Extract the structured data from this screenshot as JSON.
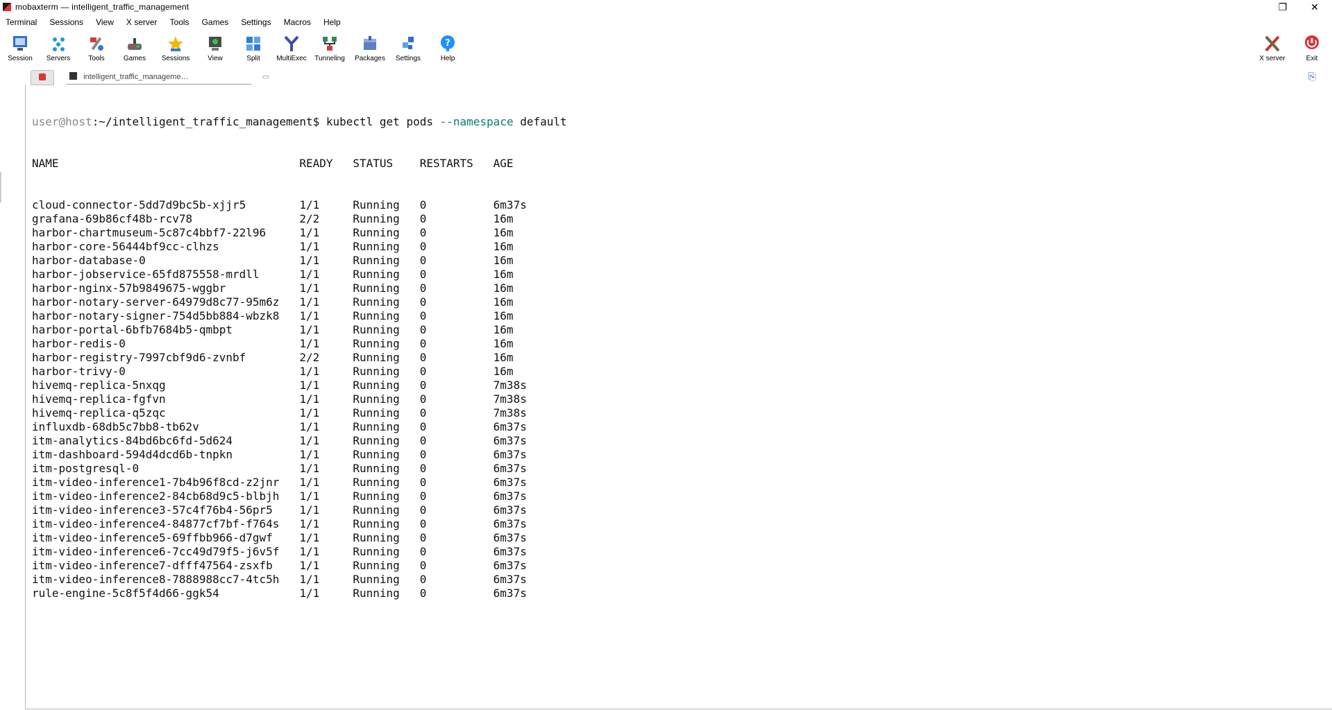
{
  "window": {
    "title": "mobaxterm — intelligent_traffic_management",
    "close_label": "✕",
    "restore_label": "❐"
  },
  "menu": [
    "Terminal",
    "Sessions",
    "View",
    "X server",
    "Tools",
    "Games",
    "Settings",
    "Macros",
    "Help"
  ],
  "toolbar": {
    "left": [
      {
        "label": "Session",
        "icon": "session-icon",
        "color": "#2f6fcf"
      },
      {
        "label": "Servers",
        "icon": "servers-icon",
        "color": "#1b9ad6"
      },
      {
        "label": "Tools",
        "icon": "tools-icon",
        "color": "#d23c3c"
      },
      {
        "label": "Games",
        "icon": "games-icon",
        "color": "#6a6a6a"
      },
      {
        "label": "Sessions",
        "icon": "star-icon",
        "color": "#f2b705"
      },
      {
        "label": "View",
        "icon": "view-icon",
        "color": "#4a4a4a"
      },
      {
        "label": "Split",
        "icon": "split-icon",
        "color": "#2c7fd6"
      },
      {
        "label": "MultiExec",
        "icon": "multiexec-icon",
        "color": "#3b4fa8"
      },
      {
        "label": "Tunneling",
        "icon": "tunneling-icon",
        "color": "#2e8b57"
      },
      {
        "label": "Packages",
        "icon": "packages-icon",
        "color": "#5b7fc7"
      },
      {
        "label": "Settings",
        "icon": "settings-icon",
        "color": "#2f6fcf"
      },
      {
        "label": "Help",
        "icon": "help-icon",
        "color": "#1e90ff"
      }
    ],
    "right": [
      {
        "label": "X server",
        "icon": "xserver-icon",
        "color": "#c0392b"
      },
      {
        "label": "Exit",
        "icon": "exit-icon",
        "color": "#e03030"
      }
    ]
  },
  "tabs": {
    "home_icon": "home-icon",
    "active_label": "intelligent_traffic_manageme…",
    "new_tab_icon": "new-tab-icon"
  },
  "terminal": {
    "prompt_host": "user@host",
    "prompt_path": ":~/intelligent_traffic_management$",
    "command": " kubectl get pods ",
    "flag": "--namespace",
    "arg": " default",
    "columns": [
      "NAME",
      "READY",
      "STATUS",
      "RESTARTS",
      "AGE"
    ],
    "rows": [
      [
        "cloud-connector-5dd7d9bc5b-xjjr5",
        "1/1",
        "Running",
        "0",
        "6m37s"
      ],
      [
        "grafana-69b86cf48b-rcv78",
        "2/2",
        "Running",
        "0",
        "16m"
      ],
      [
        "harbor-chartmuseum-5c87c4bbf7-22l96",
        "1/1",
        "Running",
        "0",
        "16m"
      ],
      [
        "harbor-core-56444bf9cc-clhzs",
        "1/1",
        "Running",
        "0",
        "16m"
      ],
      [
        "harbor-database-0",
        "1/1",
        "Running",
        "0",
        "16m"
      ],
      [
        "harbor-jobservice-65fd875558-mrdll",
        "1/1",
        "Running",
        "0",
        "16m"
      ],
      [
        "harbor-nginx-57b9849675-wggbr",
        "1/1",
        "Running",
        "0",
        "16m"
      ],
      [
        "harbor-notary-server-64979d8c77-95m6z",
        "1/1",
        "Running",
        "0",
        "16m"
      ],
      [
        "harbor-notary-signer-754d5bb884-wbzk8",
        "1/1",
        "Running",
        "0",
        "16m"
      ],
      [
        "harbor-portal-6bfb7684b5-qmbpt",
        "1/1",
        "Running",
        "0",
        "16m"
      ],
      [
        "harbor-redis-0",
        "1/1",
        "Running",
        "0",
        "16m"
      ],
      [
        "harbor-registry-7997cbf9d6-zvnbf",
        "2/2",
        "Running",
        "0",
        "16m"
      ],
      [
        "harbor-trivy-0",
        "1/1",
        "Running",
        "0",
        "16m"
      ],
      [
        "hivemq-replica-5nxqg",
        "1/1",
        "Running",
        "0",
        "7m38s"
      ],
      [
        "hivemq-replica-fgfvn",
        "1/1",
        "Running",
        "0",
        "7m38s"
      ],
      [
        "hivemq-replica-q5zqc",
        "1/1",
        "Running",
        "0",
        "7m38s"
      ],
      [
        "influxdb-68db5c7bb8-tb62v",
        "1/1",
        "Running",
        "0",
        "6m37s"
      ],
      [
        "itm-analytics-84bd6bc6fd-5d624",
        "1/1",
        "Running",
        "0",
        "6m37s"
      ],
      [
        "itm-dashboard-594d4dcd6b-tnpkn",
        "1/1",
        "Running",
        "0",
        "6m37s"
      ],
      [
        "itm-postgresql-0",
        "1/1",
        "Running",
        "0",
        "6m37s"
      ],
      [
        "itm-video-inference1-7b4b96f8cd-z2jnr",
        "1/1",
        "Running",
        "0",
        "6m37s"
      ],
      [
        "itm-video-inference2-84cb68d9c5-blbjh",
        "1/1",
        "Running",
        "0",
        "6m37s"
      ],
      [
        "itm-video-inference3-57c4f76b4-56pr5",
        "1/1",
        "Running",
        "0",
        "6m37s"
      ],
      [
        "itm-video-inference4-84877cf7bf-f764s",
        "1/1",
        "Running",
        "0",
        "6m37s"
      ],
      [
        "itm-video-inference5-69ffbb966-d7gwf",
        "1/1",
        "Running",
        "0",
        "6m37s"
      ],
      [
        "itm-video-inference6-7cc49d79f5-j6v5f",
        "1/1",
        "Running",
        "0",
        "6m37s"
      ],
      [
        "itm-video-inference7-dfff47564-zsxfb",
        "1/1",
        "Running",
        "0",
        "6m37s"
      ],
      [
        "itm-video-inference8-7888988cc7-4tc5h",
        "1/1",
        "Running",
        "0",
        "6m37s"
      ],
      [
        "rule-engine-5c8f5f4d66-ggk54",
        "1/1",
        "Running",
        "0",
        "6m37s"
      ]
    ]
  }
}
